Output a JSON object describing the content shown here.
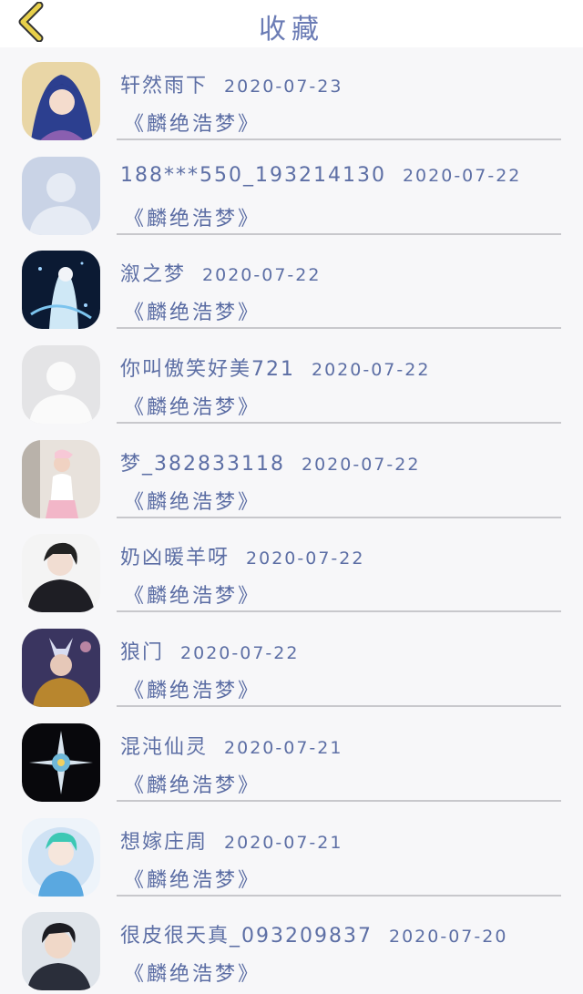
{
  "header": {
    "title": "收藏"
  },
  "items": [
    {
      "username": "轩然雨下",
      "date": "2020-07-23",
      "work": "《麟绝浩梦》",
      "avatar": "anime-avatar"
    },
    {
      "username": "188***550_193214130",
      "date": "2020-07-22",
      "work": "《麟绝浩梦》",
      "avatar": "default-avatar"
    },
    {
      "username": "溆之梦",
      "date": "2020-07-22",
      "work": "《麟绝浩梦》",
      "avatar": "anime-avatar"
    },
    {
      "username": "你叫傲笑好美721",
      "date": "2020-07-22",
      "work": "《麟绝浩梦》",
      "avatar": "default-avatar"
    },
    {
      "username": "梦_382833118",
      "date": "2020-07-22",
      "work": "《麟绝浩梦》",
      "avatar": "photo-avatar"
    },
    {
      "username": "奶凶暖羊呀",
      "date": "2020-07-22",
      "work": "《麟绝浩梦》",
      "avatar": "anime-avatar"
    },
    {
      "username": "狼门",
      "date": "2020-07-22",
      "work": "《麟绝浩梦》",
      "avatar": "anime-avatar"
    },
    {
      "username": "混沌仙灵",
      "date": "2020-07-21",
      "work": "《麟绝浩梦》",
      "avatar": "anime-avatar"
    },
    {
      "username": "想嫁庄周",
      "date": "2020-07-21",
      "work": "《麟绝浩梦》",
      "avatar": "anime-avatar"
    },
    {
      "username": "很皮很天真_093209837",
      "date": "2020-07-20",
      "work": "《麟绝浩梦》",
      "avatar": "photo-avatar"
    }
  ],
  "colors": {
    "accent": "#6b7cb5",
    "back_arrow": "#e8d04a",
    "background": "#f7f7f9"
  }
}
